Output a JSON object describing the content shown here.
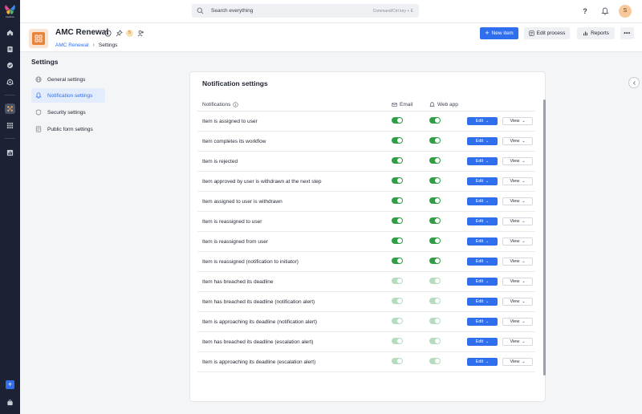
{
  "brand": {
    "logo_text": "kissflow",
    "accent": "#2f6fed"
  },
  "rail": {
    "icons": [
      "home-icon",
      "tasks-icon",
      "chat-icon",
      "community-icon",
      "apps-grid-icon",
      "all-apps-icon",
      "analytics-icon",
      "add-icon",
      "bag-icon"
    ]
  },
  "topbar": {
    "search_placeholder": "Search everything",
    "search_hint": "Command/Ctrl key + E",
    "help_label": "?",
    "avatar_initial": "S"
  },
  "header": {
    "title": "AMC Renewal",
    "badge_count": "5",
    "breadcrumb": [
      "AMC Renewal",
      "Settings"
    ],
    "new_item_label": "New item",
    "edit_process_label": "Edit process",
    "reports_label": "Reports",
    "more_label": "•••"
  },
  "settings_nav": {
    "title": "Settings",
    "items": [
      {
        "label": "General settings",
        "icon": "globe-icon"
      },
      {
        "label": "Notification settings",
        "icon": "bell-icon",
        "active": true
      },
      {
        "label": "Security settings",
        "icon": "shield-icon"
      },
      {
        "label": "Public form settings",
        "icon": "form-icon"
      }
    ]
  },
  "panel": {
    "title": "Notification settings",
    "columns": {
      "notifications": "Notifications",
      "email": "Email",
      "web_app": "Web app"
    },
    "edit_label": "Edit",
    "view_label": "View",
    "rows": [
      {
        "label": "Item is assigned to user",
        "email": true,
        "web": true
      },
      {
        "label": "Item completes its workflow",
        "email": true,
        "web": true
      },
      {
        "label": "Item is rejected",
        "email": true,
        "web": true
      },
      {
        "label": "Item approved by user is withdrawn at the next step",
        "email": true,
        "web": true
      },
      {
        "label": "Item assigned to user is withdrawn",
        "email": true,
        "web": true
      },
      {
        "label": "Item is reassigned to user",
        "email": true,
        "web": true
      },
      {
        "label": "Item is reassigned from user",
        "email": true,
        "web": true
      },
      {
        "label": "Item is reassigned (notification to initiator)",
        "email": true,
        "web": true
      },
      {
        "label": "Item has breached its deadline",
        "email": false,
        "web": false
      },
      {
        "label": "Item has breached its deadline (notification alert)",
        "email": false,
        "web": false
      },
      {
        "label": "Item is approaching its deadline (notification alert)",
        "email": false,
        "web": false
      },
      {
        "label": "Item has breached its deadline (escalation alert)",
        "email": false,
        "web": false
      },
      {
        "label": "Item is approaching its deadline (escalation alert)",
        "email": false,
        "web": false
      }
    ]
  },
  "colors": {
    "toggle_on": "#2f9e44",
    "toggle_disabled": "#b6dcbf",
    "primary": "#2f6fed"
  }
}
